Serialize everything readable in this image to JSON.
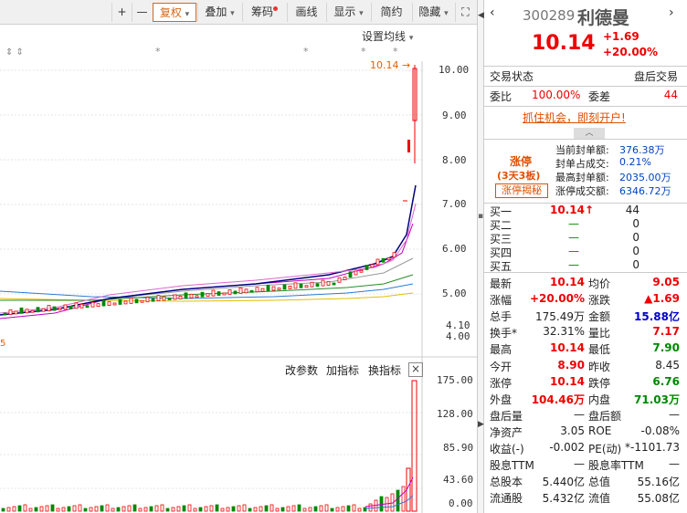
{
  "toolbar": {
    "plus": "+",
    "minus": "—",
    "fuquan": "复权",
    "diejia": "叠加",
    "chouma": "筹码",
    "huaxian": "画线",
    "xianshi": "显示",
    "jianyue": "简约",
    "yincang": "隐藏"
  },
  "chart": {
    "setting_label": "设置均线",
    "price_marker": "10.14",
    "low_marker": "5",
    "y_ticks": [
      "10.00",
      "9.00",
      "8.00",
      "7.00",
      "6.00",
      "5.00",
      "4.10",
      "4.00"
    ],
    "vol_ticks": [
      "175.00",
      "128.00",
      "85.90",
      "43.60",
      "0.00"
    ],
    "vol_toolbar": {
      "params": "改参数",
      "add": "加指标",
      "switch": "换指标",
      "close": "×"
    }
  },
  "quote": {
    "code": "300289",
    "name": "利德曼",
    "price": "10.14",
    "change": "+1.69",
    "change_pct": "+20.00%",
    "trade_status_label": "交易状态",
    "trade_status_value": "盘后交易",
    "weibi_label": "委比",
    "weibi_value": "100.00%",
    "weicha_label": "委差",
    "weicha_value": "44",
    "ad_link": "抓住机会，即刻开户!",
    "limit_title": "涨停",
    "limit_days": "(3天3板)",
    "limit_reveal": "涨停揭秘",
    "seal": [
      {
        "label": "当前封单额:",
        "value": "376.38万"
      },
      {
        "label": "封单占成交:",
        "value": "0.21%"
      },
      {
        "label": "最高封单额:",
        "value": "2035.00万"
      },
      {
        "label": "涨停成交额:",
        "value": "6346.72万"
      }
    ],
    "bids": [
      {
        "label": "买一",
        "price": "10.14↑",
        "vol": "44"
      },
      {
        "label": "买二",
        "price": "—",
        "vol": "0"
      },
      {
        "label": "买三",
        "price": "—",
        "vol": "0"
      },
      {
        "label": "买四",
        "price": "—",
        "vol": "0"
      },
      {
        "label": "买五",
        "price": "—",
        "vol": "0"
      }
    ],
    "stats": [
      {
        "l1": "最新",
        "v1": "10.14",
        "c1": "red",
        "l2": "均价",
        "v2": "9.05",
        "c2": "red"
      },
      {
        "l1": "涨幅",
        "v1": "+20.00%",
        "c1": "red",
        "l2": "涨跌",
        "v2": "▲1.69",
        "c2": "red"
      },
      {
        "l1": "总手",
        "v1": "175.49万",
        "c1": "",
        "l2": "金额",
        "v2": "15.88亿",
        "c2": "blue"
      },
      {
        "l1": "换手*",
        "v1": "32.31%",
        "c1": "",
        "l2": "量比",
        "v2": "7.17",
        "c2": "red"
      },
      {
        "l1": "最高",
        "v1": "10.14",
        "c1": "red",
        "l2": "最低",
        "v2": "7.90",
        "c2": "green"
      },
      {
        "l1": "今开",
        "v1": "8.90",
        "c1": "red",
        "l2": "昨收",
        "v2": "8.45",
        "c2": ""
      },
      {
        "l1": "涨停",
        "v1": "10.14",
        "c1": "red",
        "l2": "跌停",
        "v2": "6.76",
        "c2": "green"
      },
      {
        "l1": "外盘",
        "v1": "104.46万",
        "c1": "red",
        "l2": "内盘",
        "v2": "71.03万",
        "c2": "green"
      },
      {
        "l1": "盘后量",
        "v1": "—",
        "c1": "",
        "l2": "盘后额",
        "v2": "—",
        "c2": ""
      },
      {
        "l1": "净资产",
        "v1": "3.05",
        "c1": "",
        "l2": "ROE",
        "v2": "-0.08%",
        "c2": ""
      },
      {
        "l1": "收益(-)",
        "v1": "-0.002",
        "c1": "",
        "l2": "PE(动)",
        "v2": "*-1101.73",
        "c2": ""
      },
      {
        "l1": "股息TTM",
        "v1": "—",
        "c1": "",
        "l2": "股息率TTM",
        "v2": "—",
        "c2": ""
      },
      {
        "l1": "总股本",
        "v1": "5.440亿",
        "c1": "",
        "l2": "总值",
        "v2": "55.16亿",
        "c2": ""
      },
      {
        "l1": "流通股",
        "v1": "5.432亿",
        "c1": "",
        "l2": "流值",
        "v2": "55.08亿",
        "c2": ""
      }
    ]
  },
  "colors": {
    "up": "#e00000",
    "down": "#008000",
    "accent": "#d2691e",
    "blue": "#0000cc"
  }
}
